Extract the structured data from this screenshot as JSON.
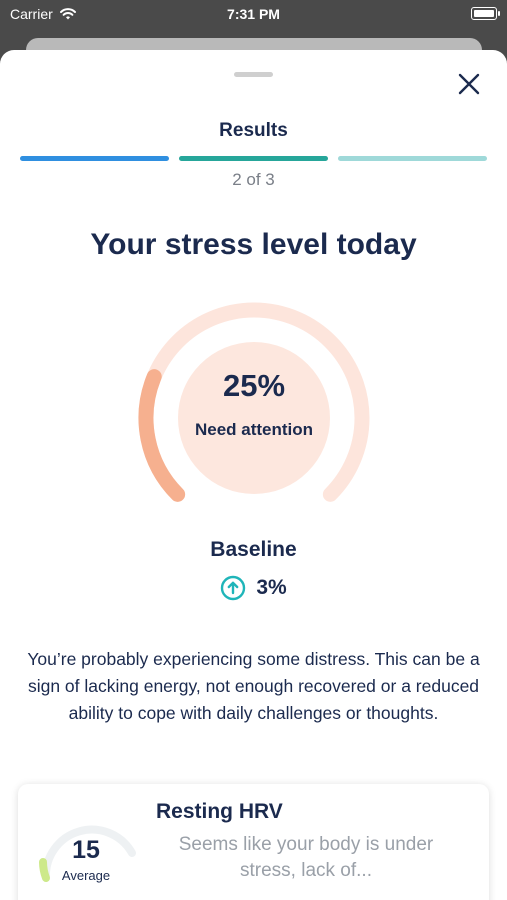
{
  "status_bar": {
    "carrier": "Carrier",
    "time": "7:31 PM"
  },
  "header": {
    "title": "Results",
    "step": "2 of 3"
  },
  "progress": {
    "colors": [
      "#2f8fe0",
      "#26a69a",
      "#9fd9d9"
    ]
  },
  "main": {
    "headline": "Your stress level today",
    "gauge": {
      "percent_label": "25%",
      "status": "Need attention",
      "value": 0.25,
      "color": "#f6b08f",
      "track_color": "#fde5dc"
    },
    "baseline": {
      "label": "Baseline",
      "value": "3%",
      "icon": "arrow-up-circle-icon"
    },
    "description": "You’re probably experiencing some distress. This can be a sign of lacking energy, not enough recovered or a reduced ability to cope with daily challenges or thoughts."
  },
  "hrv_card": {
    "title": "Resting HRV",
    "value": "15",
    "caption": "Average",
    "summary": "Seems like your body is under stress, lack of..."
  }
}
